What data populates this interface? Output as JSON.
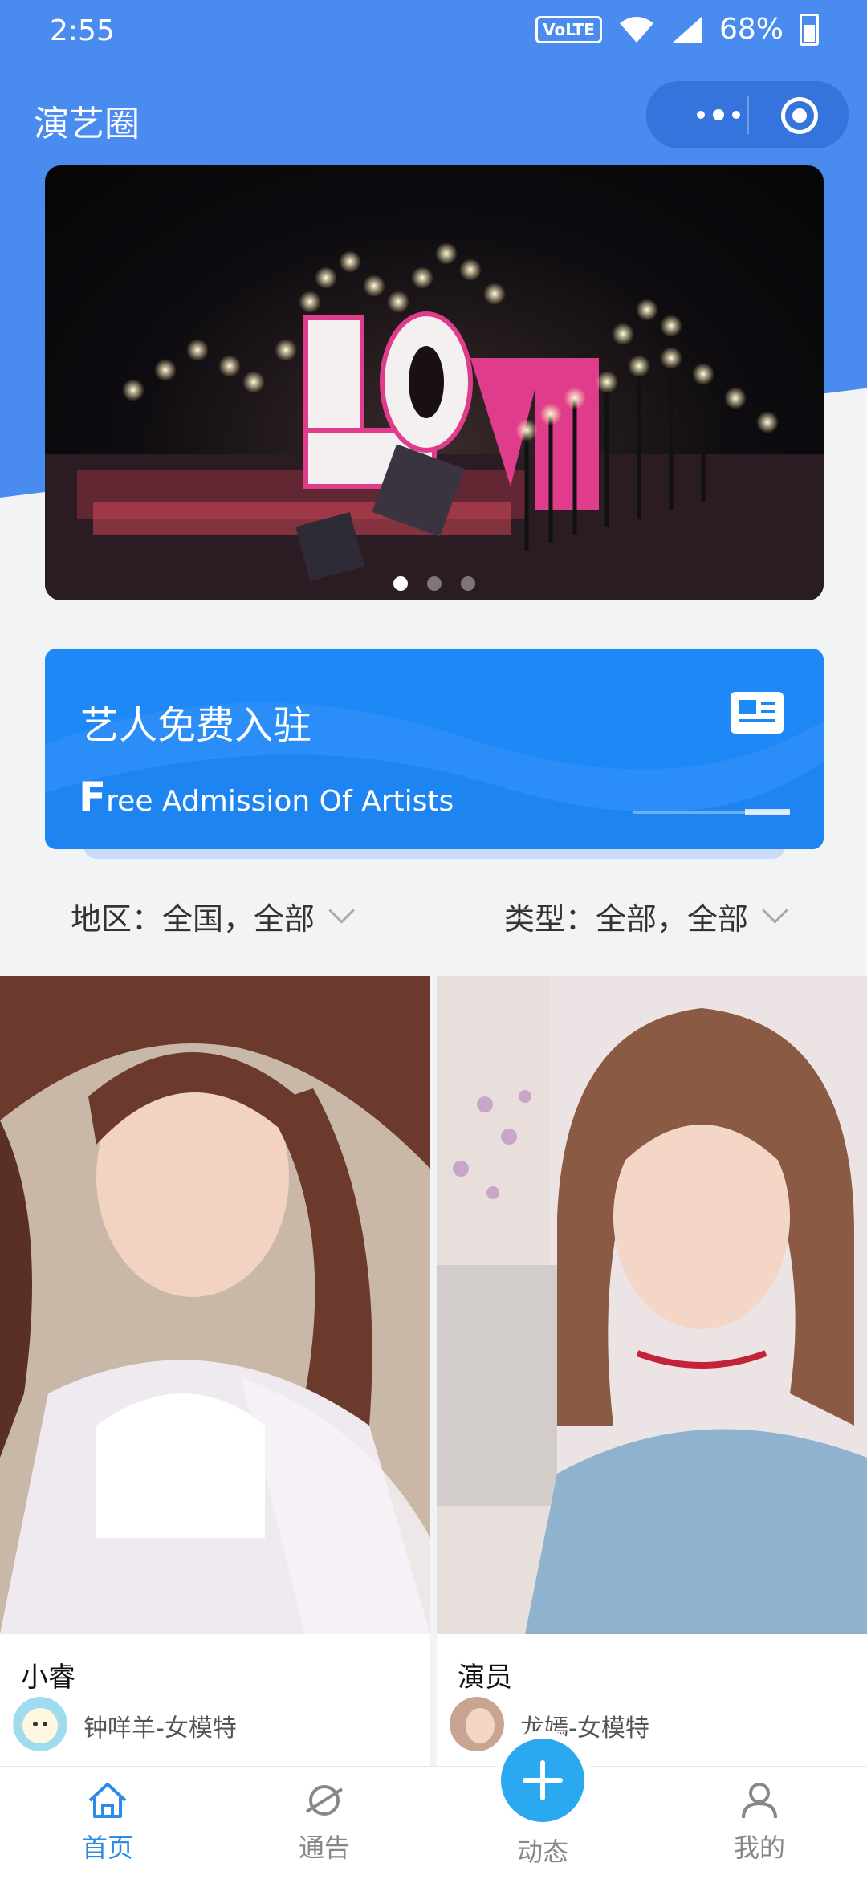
{
  "status_bar": {
    "time": "2:55",
    "volte": "VoLTE",
    "battery": "68%"
  },
  "header": {
    "title": "演艺圈"
  },
  "banner": {
    "slide_count": 3,
    "active_index": 0
  },
  "promo": {
    "title": "艺人免费入驻",
    "subtitle_initial": "F",
    "subtitle_rest": "ree Admission Of Artists"
  },
  "filters": {
    "region": "地区：全国，全部",
    "type": "类型：全部，全部"
  },
  "cards": [
    {
      "title": "小睿",
      "author": "钟咩羊-女模特"
    },
    {
      "title": "演员",
      "author": "龙嫣-女模特"
    }
  ],
  "tabbar": {
    "home": "首页",
    "notice": "通告",
    "feed": "动态",
    "mine": "我的"
  },
  "colors": {
    "accent": "#4a8bf0",
    "promo": "#1e88f7",
    "tab_active": "#2e8ae6",
    "fab": "#2aa8f0"
  }
}
